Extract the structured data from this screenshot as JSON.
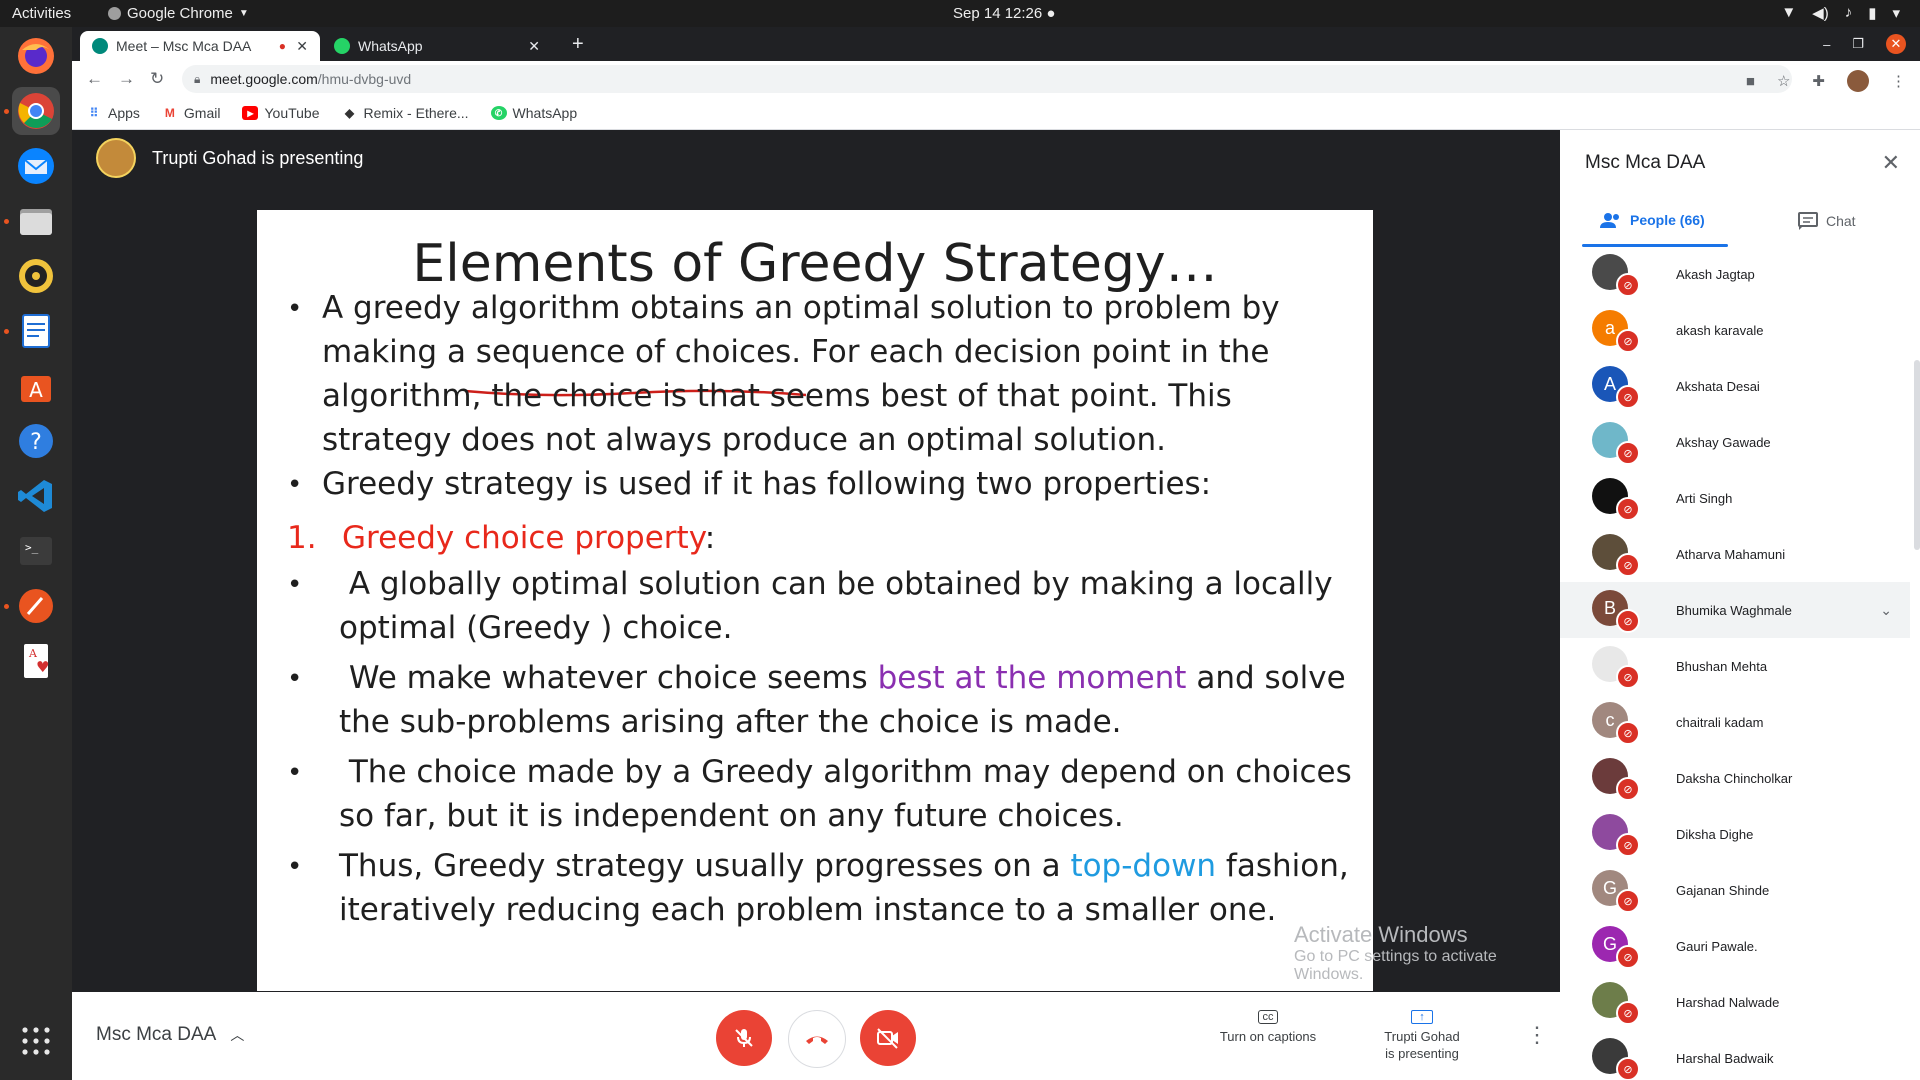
{
  "os": {
    "activities": "Activities",
    "app_name": "Google Chrome",
    "clock": "Sep 14  12:26",
    "dock_items": [
      "firefox-icon",
      "chrome-icon",
      "thunderbird-icon",
      "files-icon",
      "rhythmbox-icon",
      "writer-icon",
      "software-icon",
      "help-icon",
      "vscode-icon",
      "terminal-icon",
      "inkscape-icon",
      "cards-icon",
      "apps-grid-icon"
    ]
  },
  "browser": {
    "tabs": [
      {
        "label": "Meet – Msc Mca DAA"
      },
      {
        "label": "WhatsApp"
      }
    ],
    "url_host": "meet.google.com",
    "url_path": "/hmu-dvbg-uvd",
    "bookmarks": [
      {
        "label": "Apps",
        "icon": "apps-grid-icon"
      },
      {
        "label": "Gmail",
        "icon": "gmail-icon"
      },
      {
        "label": "YouTube",
        "icon": "youtube-icon"
      },
      {
        "label": "Remix - Ethere...",
        "icon": "remix-icon"
      },
      {
        "label": "WhatsApp",
        "icon": "whatsapp-icon"
      }
    ]
  },
  "meet": {
    "presenting_text": "Trupti Gohad is presenting",
    "meeting_name": "Msc Mca DAA",
    "captions_label": "Turn on captions",
    "presenting_btn_line1": "Trupti Gohad",
    "presenting_btn_line2": "is presenting",
    "watermark_line1": "Activate Windows",
    "watermark_line2": "Go to PC settings to activate Windows."
  },
  "slide": {
    "title": "Elements of Greedy Strategy…",
    "b1_l1": "A greedy algorithm obtains an optimal solution to problem by",
    "b1_l2": "making a sequence of choices. For each decision point in the",
    "b1_l3": "algorithm, the choice is that seems best of that point. This",
    "b1_l4": "strategy does not always produce an optimal solution.",
    "b2": "Greedy strategy is used if it has following two properties:",
    "n1_num": "1.",
    "n1_text": "Greedy choice property",
    "n1_colon": ":",
    "b3_l1": " A globally optimal solution can be obtained by making a locally",
    "b3_l2": "optimal (Greedy ) choice.",
    "b4_pre": " We make whatever choice seems ",
    "b4_hl": "best at the moment",
    "b4_post": " and solve",
    "b4_l2": "the sub-problems arising after the choice is made.",
    "b5_l1": " The choice made by a Greedy algorithm may depend on choices",
    "b5_l2": "so far, but it is independent on any future choices.",
    "b6_pre": "Thus, Greedy strategy usually progresses on a ",
    "b6_hl": "top-down",
    "b6_post": " fashion,",
    "b6_l2": "iteratively reducing each problem instance to a smaller one."
  },
  "panel": {
    "title": "Msc Mca DAA",
    "people_tab": "People (66)",
    "chat_tab": "Chat",
    "participants": [
      {
        "name": "Akash Jagtap",
        "initial": "",
        "color": "#4a4a4a"
      },
      {
        "name": "akash karavale",
        "initial": "a",
        "color": "#f57c00"
      },
      {
        "name": "Akshata Desai",
        "initial": "A",
        "color": "#1a56b8"
      },
      {
        "name": "Akshay Gawade",
        "initial": "",
        "color": "#6fb7c9"
      },
      {
        "name": "Arti Singh",
        "initial": "",
        "color": "#111111"
      },
      {
        "name": "Atharva Mahamuni",
        "initial": "",
        "color": "#5d4e3a"
      },
      {
        "name": "Bhumika Waghmale",
        "initial": "B",
        "color": "#7b4a3a"
      },
      {
        "name": "Bhushan Mehta",
        "initial": "",
        "color": "#e8e8e8"
      },
      {
        "name": "chaitrali kadam",
        "initial": "c",
        "color": "#a1887f"
      },
      {
        "name": "Daksha Chincholkar",
        "initial": "",
        "color": "#6b3b3b"
      },
      {
        "name": "Diksha Dighe",
        "initial": "",
        "color": "#8e4a9e"
      },
      {
        "name": "Gajanan Shinde",
        "initial": "G",
        "color": "#a1887f"
      },
      {
        "name": "Gauri Pawale.",
        "initial": "G",
        "color": "#9c27b0"
      },
      {
        "name": "Harshad Nalwade",
        "initial": "",
        "color": "#6d7d4a"
      },
      {
        "name": "Harshal Badwaik",
        "initial": "",
        "color": "#3a3a3a"
      }
    ]
  }
}
